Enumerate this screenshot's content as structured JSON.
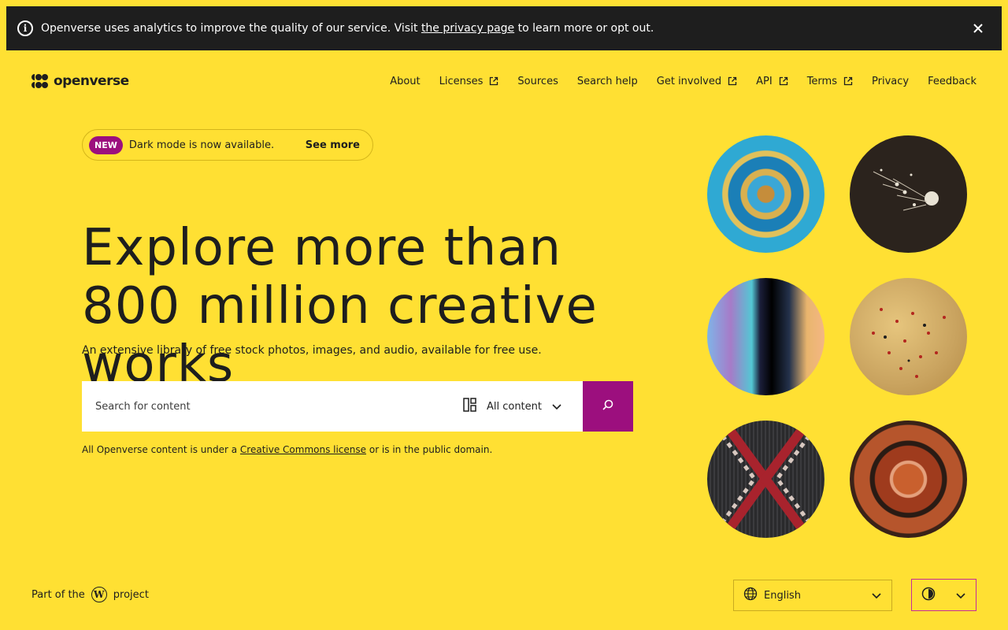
{
  "banner": {
    "text_before": "Openverse uses analytics to improve the quality of our service. Visit ",
    "link": "the privacy page",
    "text_after": " to learn more or opt out."
  },
  "header": {
    "logo": "openverse",
    "nav": [
      {
        "label": "About",
        "external": false
      },
      {
        "label": "Licenses",
        "external": true
      },
      {
        "label": "Sources",
        "external": false
      },
      {
        "label": "Search help",
        "external": false
      },
      {
        "label": "Get involved",
        "external": true
      },
      {
        "label": "API",
        "external": true
      },
      {
        "label": "Terms",
        "external": true
      },
      {
        "label": "Privacy",
        "external": false
      },
      {
        "label": "Feedback",
        "external": false
      }
    ]
  },
  "announcement": {
    "badge": "NEW",
    "text": "Dark mode is now available.",
    "action": "See more"
  },
  "hero": {
    "title": "Explore more than 800 million creative works",
    "subtitle": "An extensive library of free stock photos, images, and audio, available for free use."
  },
  "search": {
    "placeholder": "Search for content",
    "content_type": "All content"
  },
  "cc_note": {
    "before": "All Openverse content is under a ",
    "link": "Creative Commons license",
    "after": " or is in the public domain."
  },
  "footer": {
    "part_of_before": "Part of the",
    "part_of_after": "project",
    "language": "English"
  },
  "colors": {
    "background": "#ffe033",
    "accent": "#9c0f7e",
    "banner": "#1e1e1e"
  }
}
